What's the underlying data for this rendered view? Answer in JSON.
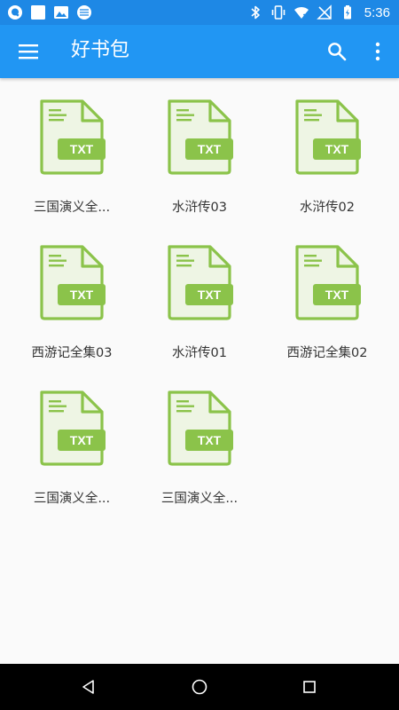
{
  "status_bar": {
    "time": "5:36",
    "left_icons": [
      "q-app-icon",
      "white-square-icon",
      "image-icon",
      "sync-icon"
    ],
    "right_icons": [
      "bluetooth-icon",
      "vibrate-icon",
      "wifi-icon",
      "no-signal-icon",
      "battery-charging-icon"
    ]
  },
  "app_bar": {
    "title": "好书包",
    "menu_icon": "menu-icon",
    "search_icon": "search-icon",
    "more_icon": "more-vert-icon"
  },
  "file_badge": "TXT",
  "files": [
    {
      "name": "三国演义全..."
    },
    {
      "name": "水浒传03"
    },
    {
      "name": "水浒传02"
    },
    {
      "name": "西游记全集03"
    },
    {
      "name": "水浒传01"
    },
    {
      "name": "西游记全集02"
    },
    {
      "name": "三国演义全..."
    },
    {
      "name": "三国演义全..."
    }
  ],
  "colors": {
    "status_bar": "#1e88e5",
    "app_bar": "#2196f3",
    "file_icon_green": "#8bc34a",
    "background": "#fafafa",
    "nav_bar": "#000000"
  },
  "nav_bar": {
    "icons": [
      "back-icon",
      "home-icon",
      "recents-icon"
    ]
  }
}
